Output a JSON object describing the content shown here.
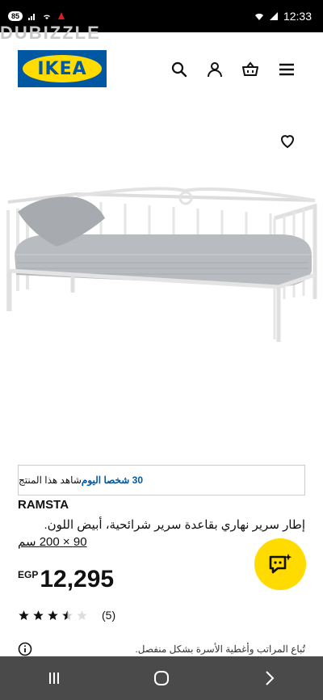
{
  "status_bar": {
    "battery_badge": "85",
    "time": "12:33"
  },
  "watermark": "DUBIZZLE",
  "header": {
    "logo_text": "IKEA",
    "icons": [
      "search-icon",
      "profile-icon",
      "cart-icon",
      "menu-icon"
    ]
  },
  "product": {
    "viewers_count": "30 شخصا اليوم",
    "viewers_suffix": "شاهد هذا المنتج",
    "name": "RAMSTA",
    "description": "إطار سرير نهاري بقاعدة سرير شرائحية، أبيض اللون.",
    "size": "90 × 200 سم",
    "currency": "EGP",
    "price": "12,295",
    "rating": 3.5,
    "rating_count": "(5)",
    "note": "تُباع المراتب وأغطية الأسرة بشكل منفصل."
  },
  "colors": {
    "ikea_blue": "#0058a3",
    "ikea_yellow": "#ffdb00",
    "nav_bar": "#4a4a4a"
  }
}
